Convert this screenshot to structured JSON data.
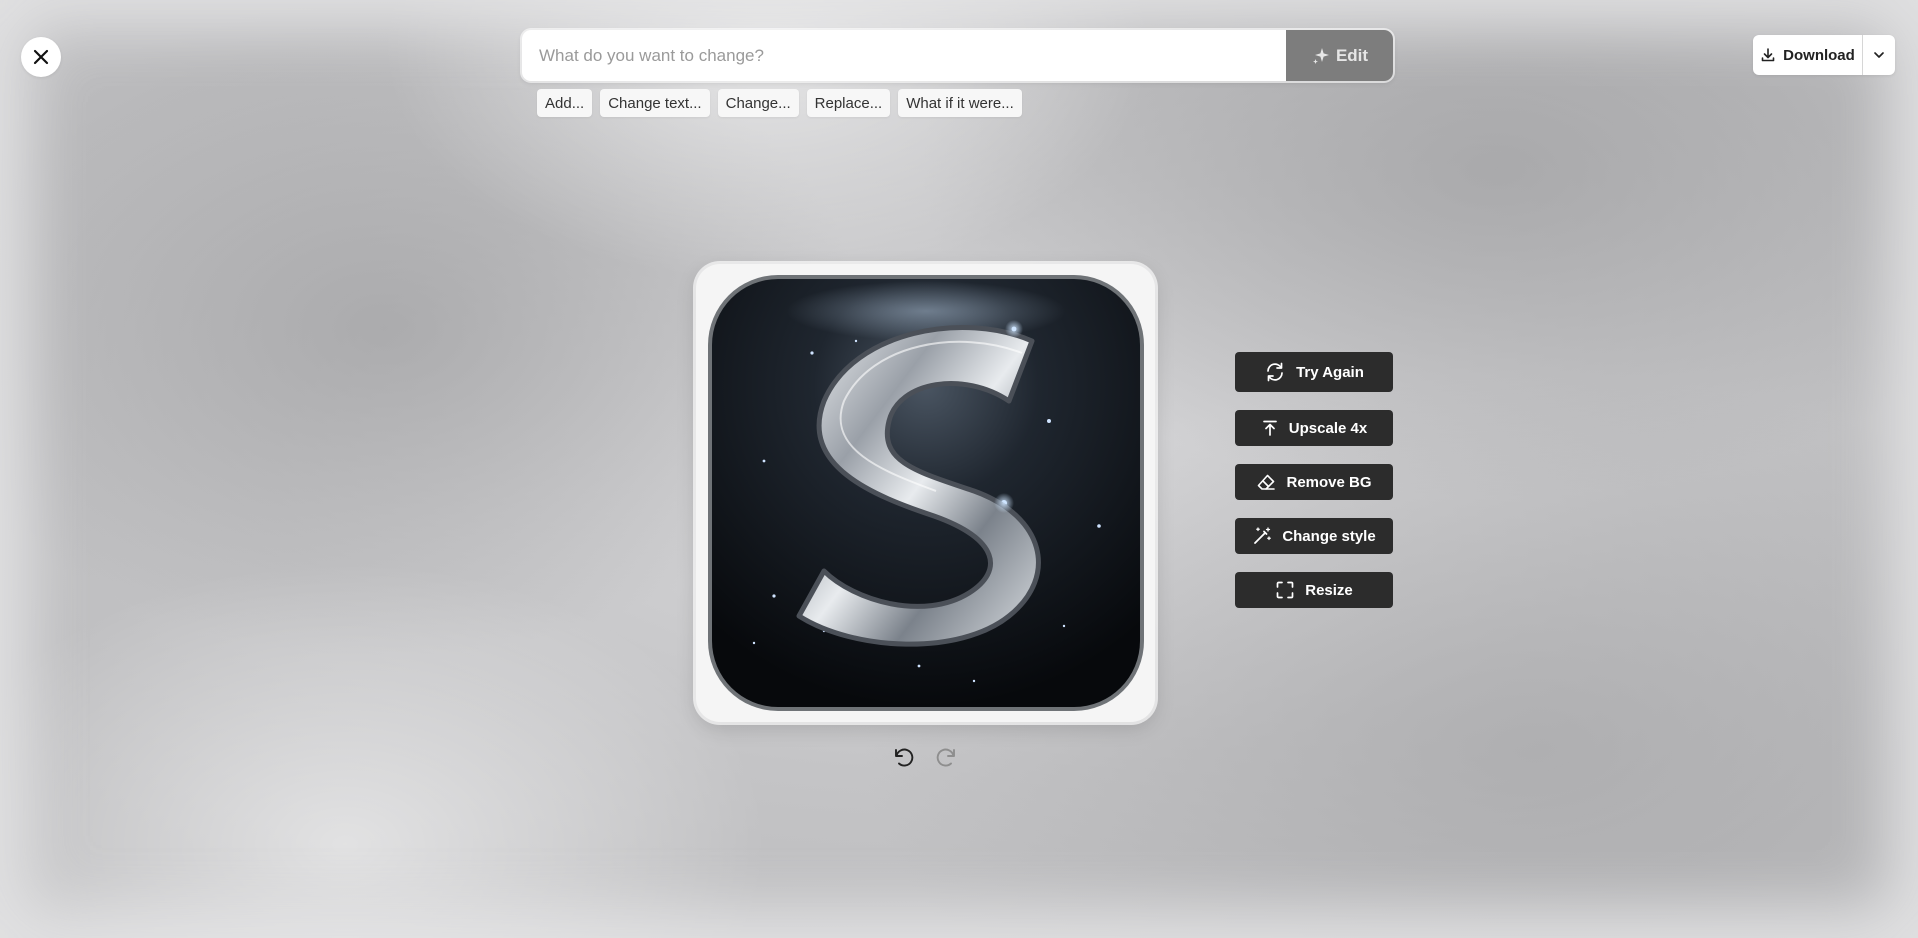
{
  "prompt": {
    "placeholder": "What do you want to change?",
    "value": "",
    "edit_label": "Edit",
    "edit_icon": "sparkle-icon"
  },
  "suggestions": [
    "Add...",
    "Change text...",
    "Change...",
    "Replace...",
    "What if it were..."
  ],
  "download": {
    "label": "Download",
    "icon": "download-icon",
    "menu_icon": "chevron-down-icon"
  },
  "close_icon": "close-icon",
  "image": {
    "content": "silver-s-app-icon",
    "letter": "S"
  },
  "actions": [
    {
      "label": "Try Again",
      "icon": "refresh-icon"
    },
    {
      "label": "Upscale 4x",
      "icon": "upscale-icon"
    },
    {
      "label": "Remove BG",
      "icon": "eraser-icon"
    },
    {
      "label": "Change style",
      "icon": "magic-wand-icon"
    },
    {
      "label": "Resize",
      "icon": "resize-icon"
    }
  ],
  "history": {
    "undo_icon": "undo-icon",
    "redo_icon": "redo-icon"
  },
  "colors": {
    "action_bg": "#2c2c2c",
    "edit_bg": "#7d7d7d",
    "page_bg": "#c8c8ca"
  }
}
